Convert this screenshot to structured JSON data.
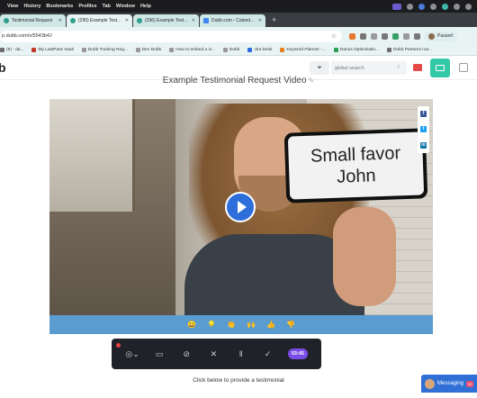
{
  "menubar": {
    "items": [
      "View",
      "History",
      "Bookmarks",
      "Profiles",
      "Tab",
      "Window",
      "Help"
    ]
  },
  "tabs": [
    {
      "label": "Testimonial Request",
      "active": false
    },
    {
      "label": "(295) Example Testimonial Re...",
      "active": true
    },
    {
      "label": "(296) Example Testimonial Re...",
      "active": false
    },
    {
      "label": "Dubb.com - Calendar - Friday...",
      "active": false
    }
  ],
  "address": {
    "url": "p.dubb.com/v/5543b4J",
    "profile_label": "Paused"
  },
  "bookmarks": [
    {
      "label": "(9) - da...",
      "icon": "folder"
    },
    {
      "label": "My LastPass Vault",
      "icon": "red"
    },
    {
      "label": "Dubb Training Reg...",
      "icon": "grey"
    },
    {
      "label": "Dev Dubb",
      "icon": "grey"
    },
    {
      "label": "How to embed a vi...",
      "icon": "grey"
    },
    {
      "label": "Dubb",
      "icon": "grey"
    },
    {
      "label": "Jira Desk",
      "icon": "blue"
    },
    {
      "label": "Keyword Planner -...",
      "icon": "orange"
    },
    {
      "label": "Darius Optimizatio...",
      "icon": "green"
    },
    {
      "label": "Dubb Partners not...",
      "icon": "folder"
    }
  ],
  "header": {
    "logo": "b",
    "search_placeholder": "global search"
  },
  "video": {
    "title": "Example Testimonial Request Video",
    "phone_line1": "Small favor",
    "phone_line2": "John",
    "share": [
      "f",
      "t",
      "in"
    ]
  },
  "reactions": [
    "😀",
    "💡",
    "👏",
    "🙌",
    "👍",
    "👎"
  ],
  "recorder": {
    "timer": "03:45"
  },
  "cta": "Click below to provide a testimonial",
  "messaging": {
    "label": "Messaging",
    "badge": "99"
  }
}
